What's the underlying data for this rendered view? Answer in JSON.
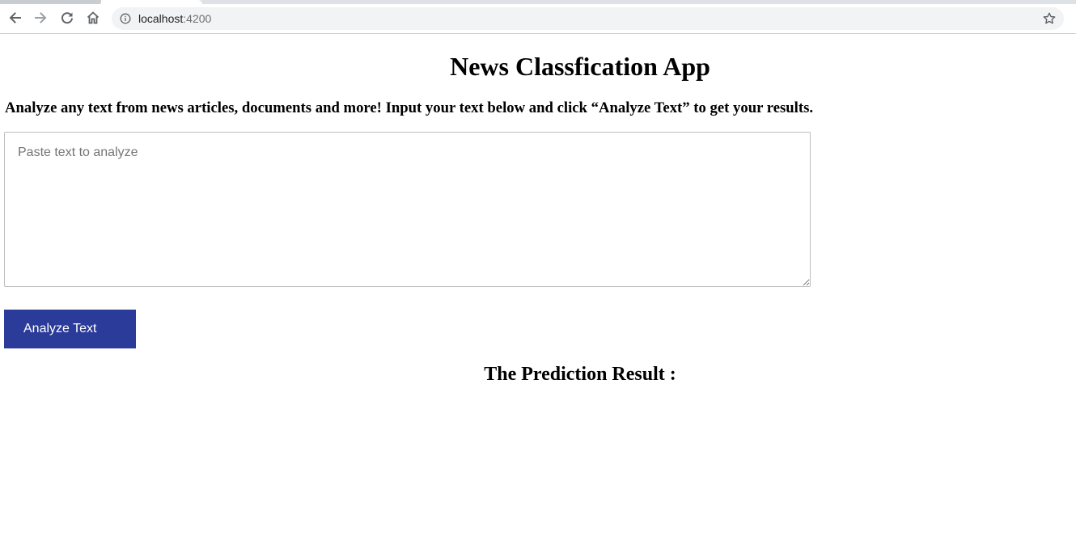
{
  "browser": {
    "url_host": "localhost",
    "url_port": ":4200",
    "icons": {
      "back": "back-arrow-icon",
      "forward": "forward-arrow-icon",
      "reload": "reload-icon",
      "home": "home-icon",
      "info": "info-icon",
      "bookmark": "star-icon"
    }
  },
  "page": {
    "title": "News Classfication App",
    "intro": "Analyze any text from news articles, documents and more! Input your text below and click “Analyze Text” to get your results.",
    "text_input": {
      "placeholder": "Paste text to analyze",
      "value": ""
    },
    "analyze_button_label": "Analyze Text",
    "result_heading": "The Prediction Result :",
    "colors": {
      "button_background": "#2b3b9a",
      "button_text": "#ffffff"
    }
  }
}
